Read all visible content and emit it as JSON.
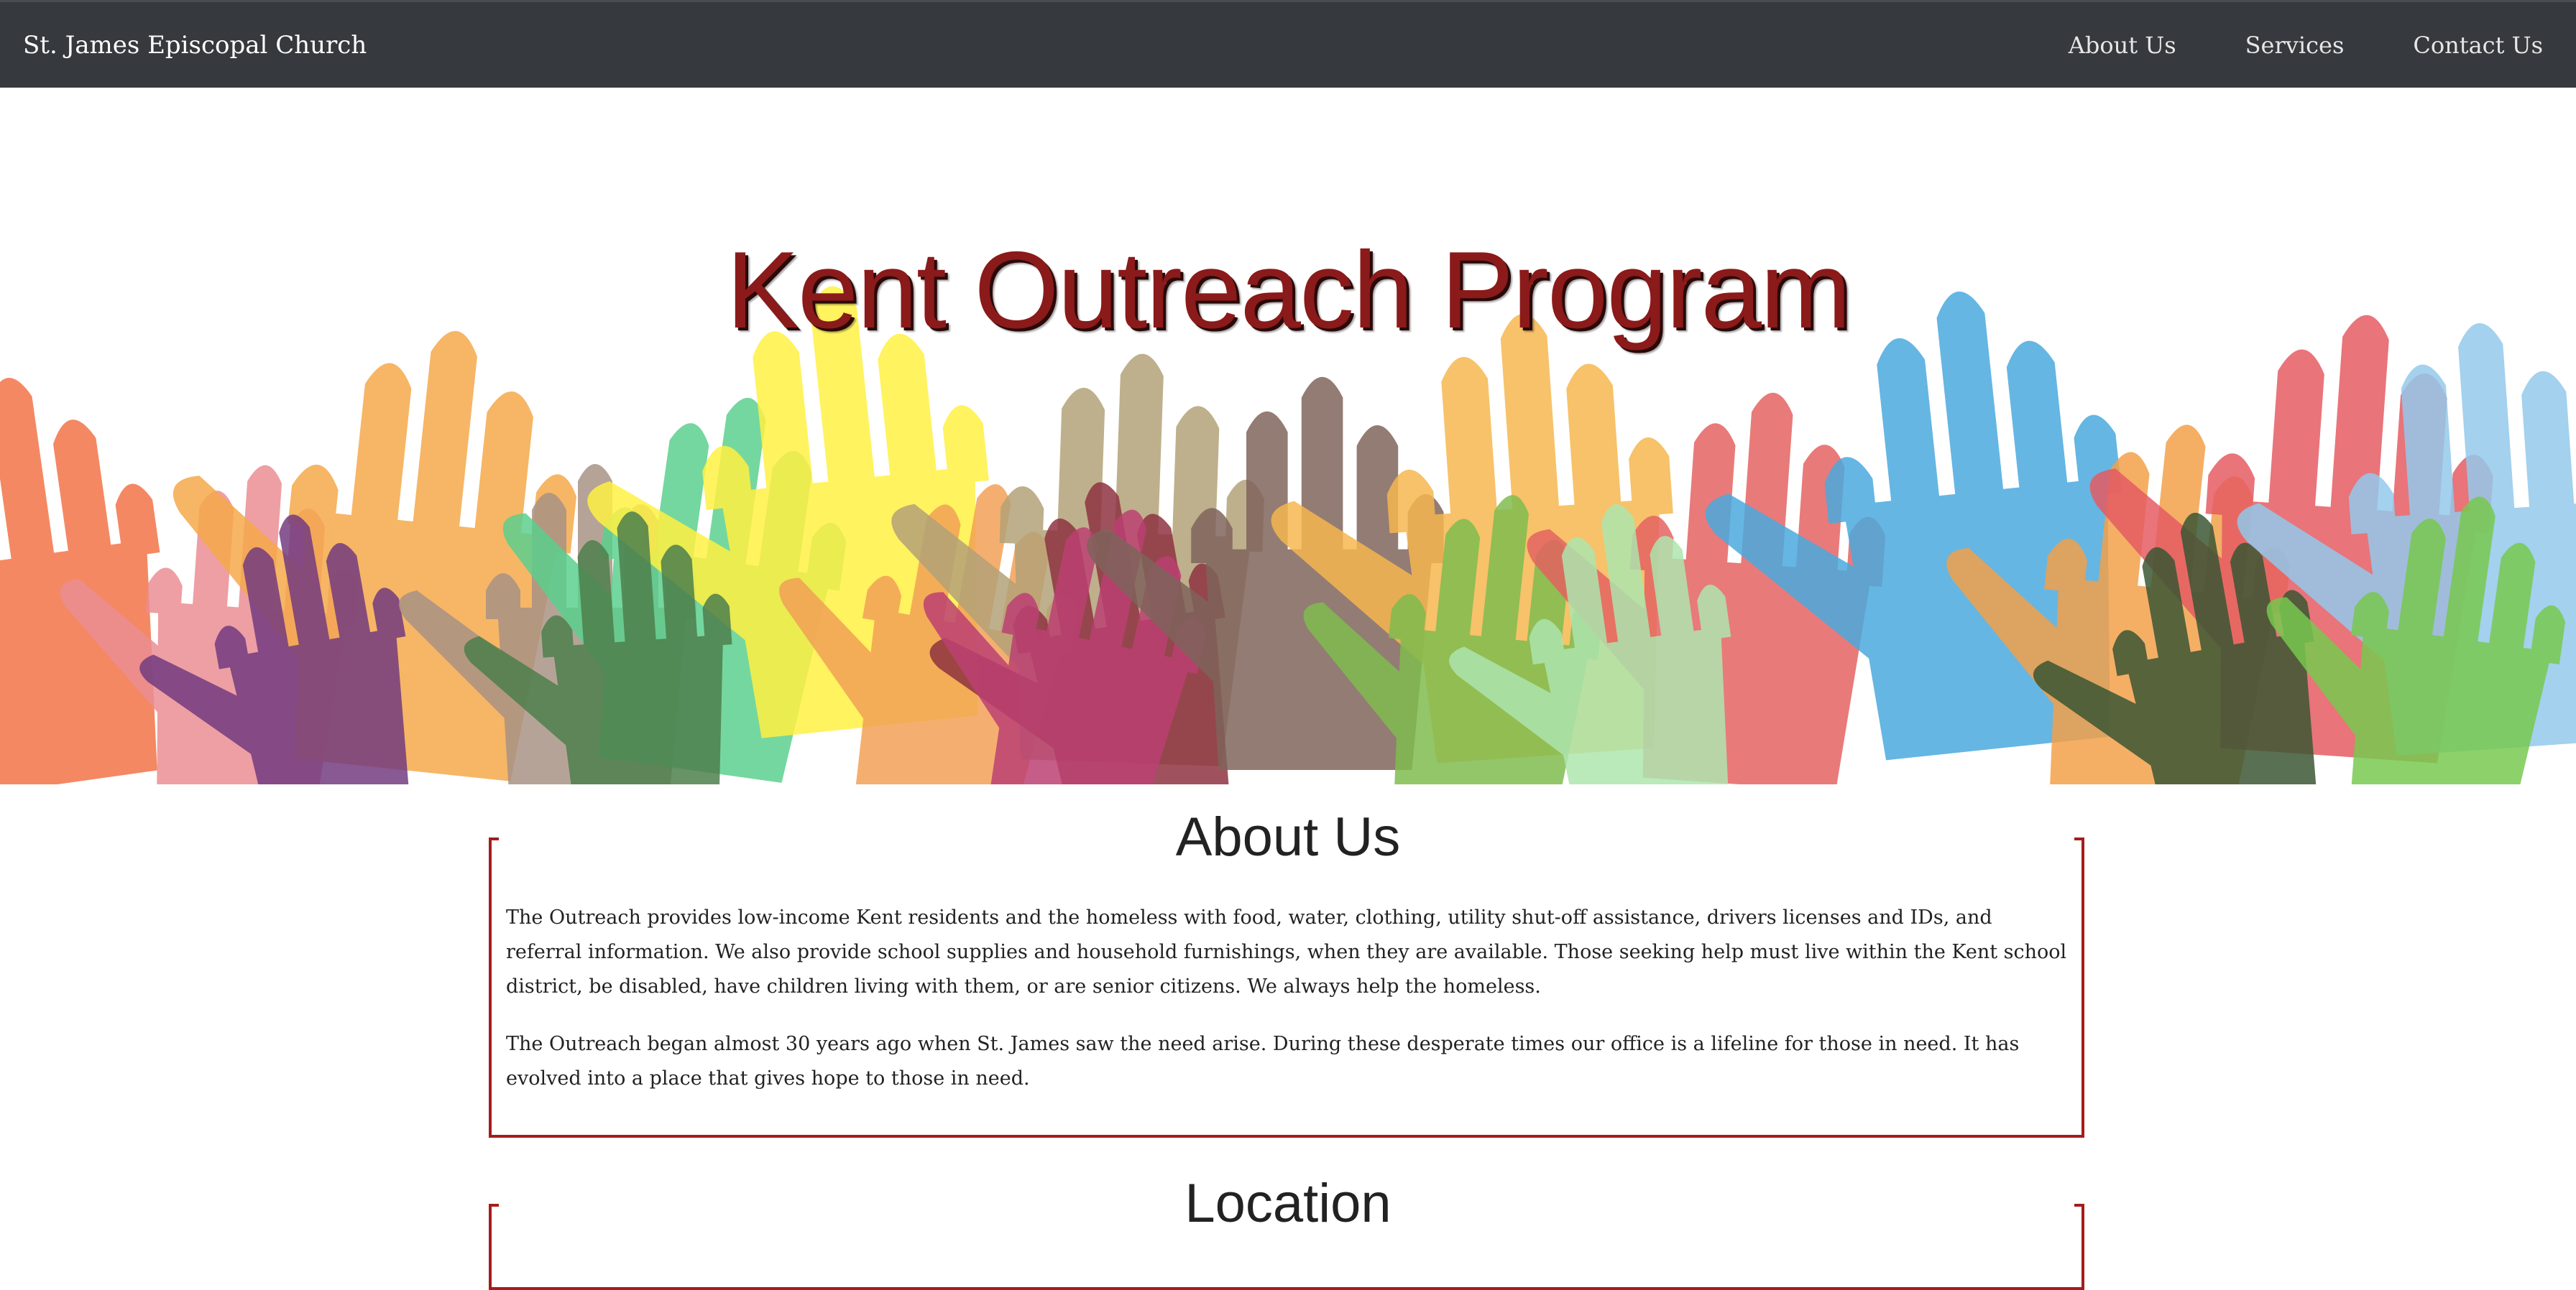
{
  "navbar": {
    "brand": "St. James Episcopal Church",
    "links": [
      "About Us",
      "Services",
      "Contact Us"
    ]
  },
  "hero": {
    "title": "Kent Outreach Program",
    "image": "raised-hands-illustration"
  },
  "about": {
    "heading": "About Us",
    "paragraphs": [
      "The Outreach provides low-income Kent residents and the homeless with food, water, clothing, utility shut-off assistance, drivers licenses and IDs, and referral information. We also provide school supplies and household furnishings, when they are available. Those seeking help must live within the Kent school district, be disabled, have children living with them, or are senior citizens. We always help the homeless.",
      "The Outreach began almost 30 years ago when St. James saw the need arise. During these desperate times our office is a lifeline for those in need. It has evolved into a place that gives hope to those in need."
    ]
  },
  "location": {
    "heading": "Location"
  },
  "colors": {
    "navbar_bg": "#363a3e",
    "accent": "#a51c1c",
    "title": "#8b1a1a"
  }
}
